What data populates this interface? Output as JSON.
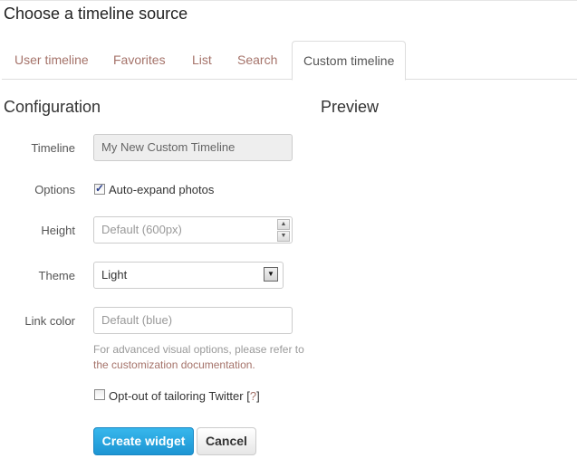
{
  "header": {
    "title": "Choose a timeline source"
  },
  "tabs": [
    {
      "label": "User timeline",
      "active": false
    },
    {
      "label": "Favorites",
      "active": false
    },
    {
      "label": "List",
      "active": false
    },
    {
      "label": "Search",
      "active": false
    },
    {
      "label": "Custom timeline",
      "active": true
    }
  ],
  "configuration": {
    "title": "Configuration",
    "timeline": {
      "label": "Timeline",
      "value": "My New Custom Timeline"
    },
    "options": {
      "label": "Options",
      "auto_expand_label": "Auto-expand photos",
      "auto_expand_checked": true
    },
    "height": {
      "label": "Height",
      "placeholder": "Default (600px)",
      "spin_up": "▲",
      "spin_down": "▼"
    },
    "theme": {
      "label": "Theme",
      "selected": "Light",
      "arrow": "▼"
    },
    "link_color": {
      "label": "Link color",
      "placeholder": "Default (blue)"
    },
    "help_text": "For advanced visual options, please refer to",
    "help_link": "the customization documentation.",
    "opt_out": {
      "label": "Opt-out of tailoring Twitter",
      "help_open": "[",
      "help_q": "?",
      "help_close": "]",
      "checked": false
    },
    "create_button": "Create widget",
    "cancel_button": "Cancel"
  },
  "preview": {
    "title": "Preview"
  },
  "colors": {
    "link": "#a5736a",
    "primary": "#1d95d3"
  }
}
